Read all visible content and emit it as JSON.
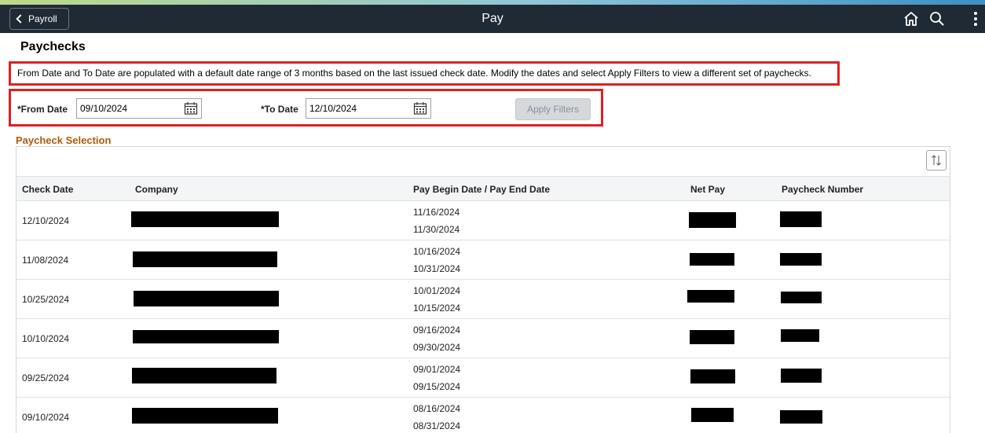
{
  "topbar": {
    "back_label": "Payroll",
    "title": "Pay",
    "icons": [
      "chevron-left-icon",
      "home-icon",
      "search-icon",
      "more-vertical-icon"
    ],
    "bg_color": "#1f2a35"
  },
  "page": {
    "title": "Paychecks",
    "info_text": "From Date and To Date are populated with a default date range of 3 months based on the last issued check date. Modify the dates and select Apply Filters to view a different set of paychecks."
  },
  "filters": {
    "from_label": "*From Date",
    "from_value": "09/10/2024",
    "to_label": "*To Date",
    "to_value": "12/10/2024",
    "apply_label": "Apply Filters"
  },
  "section": {
    "title": "Paycheck Selection",
    "title_color": "#b0590f"
  },
  "table": {
    "columns": [
      "Check Date",
      "Company",
      "Pay Begin Date / Pay End Date",
      "Net Pay",
      "Paycheck Number"
    ],
    "rows": [
      {
        "check_date": "12/10/2024",
        "pay_begin": "11/16/2024",
        "pay_end": "11/30/2024"
      },
      {
        "check_date": "11/08/2024",
        "pay_begin": "10/16/2024",
        "pay_end": "10/31/2024"
      },
      {
        "check_date": "10/25/2024",
        "pay_begin": "10/01/2024",
        "pay_end": "10/15/2024"
      },
      {
        "check_date": "10/10/2024",
        "pay_begin": "09/16/2024",
        "pay_end": "09/30/2024"
      },
      {
        "check_date": "09/25/2024",
        "pay_begin": "09/01/2024",
        "pay_end": "09/15/2024"
      },
      {
        "check_date": "09/10/2024",
        "pay_begin": "08/16/2024",
        "pay_end": "08/31/2024"
      }
    ]
  }
}
